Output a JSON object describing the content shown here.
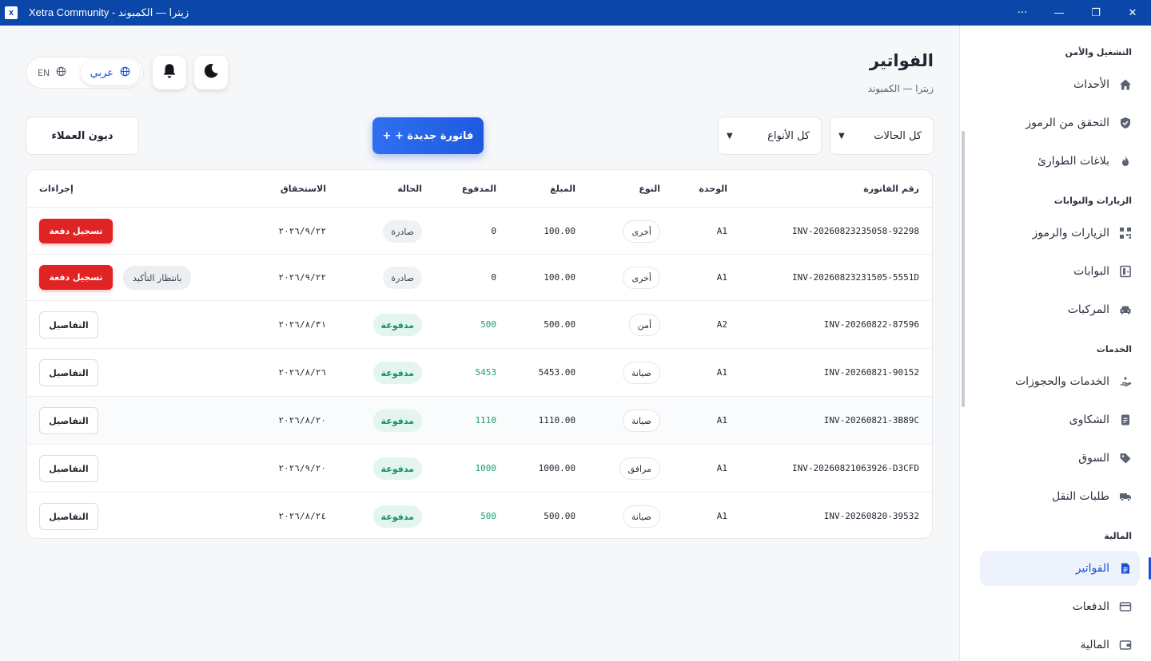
{
  "window": {
    "title": "Xetra Community - زيترا — الكمبوند",
    "logo_text": "X",
    "controls": {
      "more": "···",
      "minimize": "—",
      "restore": "❐",
      "close": "✕"
    }
  },
  "sidebar": {
    "sections": [
      {
        "title": "التشغيل والأمن",
        "items": [
          {
            "label": "الأحداث",
            "icon": "home-icon"
          },
          {
            "label": "التحقق من الرموز",
            "icon": "shield-check-icon"
          },
          {
            "label": "بلاغات الطوارئ",
            "icon": "fire-icon"
          }
        ]
      },
      {
        "title": "الزيارات والبوابات",
        "items": [
          {
            "label": "الزيارات والرموز",
            "icon": "qr-code-icon"
          },
          {
            "label": "البوابات",
            "icon": "gate-icon"
          },
          {
            "label": "المركبات",
            "icon": "car-icon"
          }
        ]
      },
      {
        "title": "الخدمات",
        "items": [
          {
            "label": "الخدمات والحجوزات",
            "icon": "hand-service-icon"
          },
          {
            "label": "الشكاوى",
            "icon": "clipboard-icon"
          },
          {
            "label": "السوق",
            "icon": "tag-icon"
          },
          {
            "label": "طلبات النقل",
            "icon": "truck-icon"
          }
        ]
      },
      {
        "title": "المالية",
        "items": [
          {
            "label": "الفواتير",
            "icon": "invoice-icon",
            "active": true
          },
          {
            "label": "الدفعات",
            "icon": "credit-card-icon"
          },
          {
            "label": "المالية",
            "icon": "wallet-icon"
          }
        ]
      }
    ]
  },
  "header": {
    "title": "الفواتير",
    "subtitle": "زيترا — الكمبوند",
    "lang_ar": "عربي",
    "lang_en": "EN"
  },
  "filters": {
    "status": "كل الحالات",
    "type": "كل الأنواع",
    "new_invoice": "+ + فاتورة جديدة",
    "customer_debts": "ديون العملاء"
  },
  "table": {
    "columns": {
      "invoice_no": "رقم الفاتورة",
      "unit": "الوحدة",
      "type": "النوع",
      "amount": "المبلغ",
      "paid": "المدفوع",
      "status": "الحالة",
      "due": "الاستحقاق",
      "actions": "إجراءات"
    },
    "rows": [
      {
        "invoice_no": "INV-20260823235058-92298",
        "unit": "A1",
        "type": "أخرى",
        "amount": "100.00",
        "paid": "0",
        "status": "صادرة",
        "due": "٢٠٢٦/٩/٢٢",
        "pay": "تسجيل دفعة"
      },
      {
        "invoice_no": "INV-20260823231505-5551D",
        "unit": "A1",
        "type": "أخرى",
        "amount": "100.00",
        "paid": "0",
        "status": "صادرة",
        "due": "٢٠٢٦/٩/٢٢",
        "pay": "تسجيل دفعة",
        "pending": "بانتظار التأكيد"
      },
      {
        "invoice_no": "INV-20260822-87596",
        "unit": "A2",
        "type": "أمن",
        "amount": "500.00",
        "paid": "500",
        "status": "مدفوعة",
        "due": "٢٠٢٦/٨/٣١",
        "details": "التفاصيل"
      },
      {
        "invoice_no": "INV-20260821-90152",
        "unit": "A1",
        "type": "صيانة",
        "amount": "5453.00",
        "paid": "5453",
        "status": "مدفوعة",
        "due": "٢٠٢٦/٨/٢٦",
        "details": "التفاصيل"
      },
      {
        "invoice_no": "INV-20260821-3B89C",
        "unit": "A1",
        "type": "صيانة",
        "amount": "1110.00",
        "paid": "1110",
        "status": "مدفوعة",
        "due": "٢٠٢٦/٨/٢٠",
        "details": "التفاصيل"
      },
      {
        "invoice_no": "INV-20260821063926-D3CFD",
        "unit": "A1",
        "type": "مرافق",
        "amount": "1000.00",
        "paid": "1000",
        "status": "مدفوعة",
        "due": "٢٠٢٦/٩/٢٠",
        "details": "التفاصيل"
      },
      {
        "invoice_no": "INV-20260820-39532",
        "unit": "A1",
        "type": "صيانة",
        "amount": "500.00",
        "paid": "500",
        "status": "مدفوعة",
        "due": "٢٠٢٦/٨/٢٤",
        "details": "التفاصيل"
      }
    ]
  },
  "colors": {
    "titlebar": "#0a47a8",
    "accent": "#1d4ed8",
    "danger": "#e02424",
    "paid": "#16a06a"
  }
}
